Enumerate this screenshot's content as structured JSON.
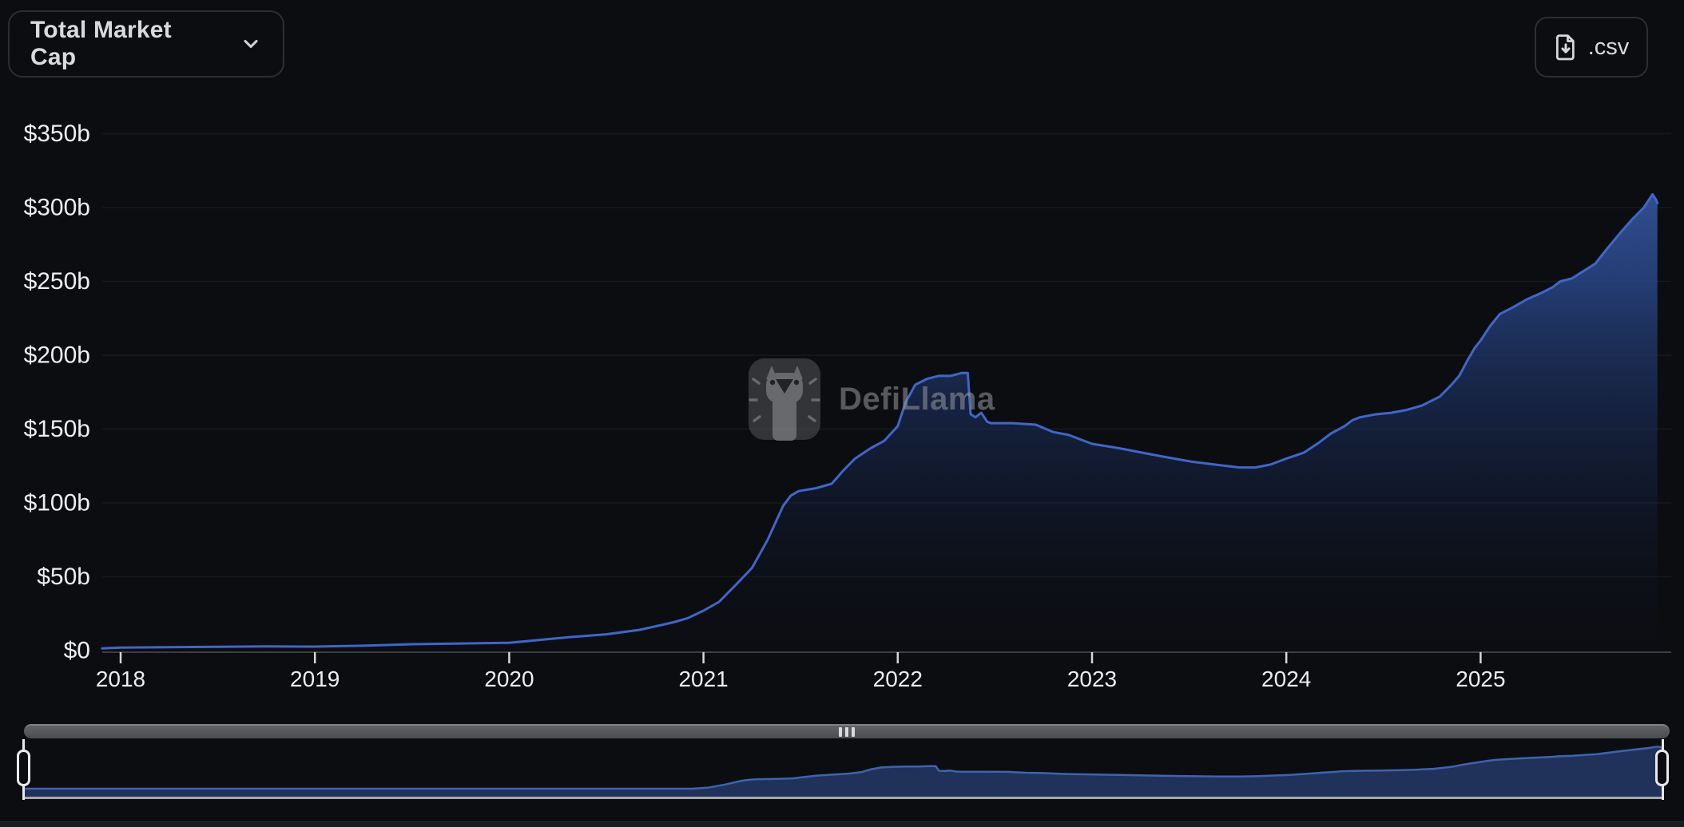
{
  "header": {
    "dropdown": {
      "label": "Total Market Cap"
    },
    "csv_button": {
      "label": ".csv"
    }
  },
  "watermark": {
    "text": "DefiLlama"
  },
  "colors": {
    "background": "#0c0d10",
    "line": "#4066c9",
    "area_top": "#3c60ae",
    "axis_text": "#edeeef",
    "axis_line": "#3d3e43",
    "tick": "#d6d7d9",
    "button_border": "#2c2e33",
    "button_text": "#d9dadc",
    "navigator_fill": "#22355e",
    "navigator_line": "#3e63b2",
    "scrollbar": "#55565a"
  },
  "chart_data": {
    "type": "area",
    "title": "Total Market Cap",
    "unit": "USD billions",
    "legend": [],
    "grid": "faint horizontal lines at each $50b",
    "x_axis": {
      "ticks": [
        2018,
        2019,
        2020,
        2021,
        2022,
        2023,
        2024,
        2025
      ]
    },
    "y_axis": {
      "range": [
        0,
        350
      ],
      "ticks": [
        {
          "value": 0,
          "label": "$0"
        },
        {
          "value": 50,
          "label": "$50b"
        },
        {
          "value": 100,
          "label": "$100b"
        },
        {
          "value": 150,
          "label": "$150b"
        },
        {
          "value": 200,
          "label": "$200b"
        },
        {
          "value": 250,
          "label": "$250b"
        },
        {
          "value": 300,
          "label": "$300b"
        },
        {
          "value": 350,
          "label": "$350b"
        }
      ]
    },
    "series": [
      {
        "name": "Total Market Cap",
        "points": [
          [
            2017.905,
            1.5
          ],
          [
            2018.0,
            2.0
          ],
          [
            2018.25,
            2.3
          ],
          [
            2018.5,
            2.6
          ],
          [
            2018.75,
            2.8
          ],
          [
            2019.0,
            2.7
          ],
          [
            2019.25,
            3.3
          ],
          [
            2019.5,
            4.3
          ],
          [
            2019.75,
            4.8
          ],
          [
            2020.0,
            5.3
          ],
          [
            2020.18,
            7.5
          ],
          [
            2020.3,
            9.0
          ],
          [
            2020.5,
            11.0
          ],
          [
            2020.67,
            14.0
          ],
          [
            2020.84,
            19.0
          ],
          [
            2020.92,
            22.0
          ],
          [
            2021.0,
            27.0
          ],
          [
            2021.08,
            33.0
          ],
          [
            2021.17,
            45.0
          ],
          [
            2021.25,
            56.0
          ],
          [
            2021.33,
            75.0
          ],
          [
            2021.41,
            98.0
          ],
          [
            2021.45,
            105.0
          ],
          [
            2021.49,
            108.0
          ],
          [
            2021.58,
            110.0
          ],
          [
            2021.66,
            113.0
          ],
          [
            2021.72,
            122.0
          ],
          [
            2021.78,
            130.0
          ],
          [
            2021.86,
            137.0
          ],
          [
            2021.93,
            142.0
          ],
          [
            2022.0,
            152.0
          ],
          [
            2022.04,
            168.0
          ],
          [
            2022.09,
            180.0
          ],
          [
            2022.15,
            184.0
          ],
          [
            2022.21,
            186.0
          ],
          [
            2022.27,
            186.0
          ],
          [
            2022.33,
            188.0
          ],
          [
            2022.36,
            188.0
          ],
          [
            2022.375,
            160.0
          ],
          [
            2022.4,
            158.0
          ],
          [
            2022.43,
            161.0
          ],
          [
            2022.46,
            155.0
          ],
          [
            2022.48,
            154.0
          ],
          [
            2022.59,
            154.0
          ],
          [
            2022.71,
            153.0
          ],
          [
            2022.8,
            148.0
          ],
          [
            2022.88,
            146.0
          ],
          [
            2023.0,
            140.0
          ],
          [
            2023.14,
            137.0
          ],
          [
            2023.26,
            134.0
          ],
          [
            2023.38,
            131.0
          ],
          [
            2023.51,
            128.0
          ],
          [
            2023.63,
            126.0
          ],
          [
            2023.76,
            124.0
          ],
          [
            2023.84,
            124.0
          ],
          [
            2023.92,
            126.0
          ],
          [
            2024.0,
            130.0
          ],
          [
            2024.09,
            134.0
          ],
          [
            2024.17,
            141.0
          ],
          [
            2024.23,
            147.0
          ],
          [
            2024.3,
            152.0
          ],
          [
            2024.34,
            156.0
          ],
          [
            2024.38,
            158.0
          ],
          [
            2024.46,
            160.0
          ],
          [
            2024.54,
            161.0
          ],
          [
            2024.62,
            163.0
          ],
          [
            2024.7,
            166.0
          ],
          [
            2024.79,
            172.0
          ],
          [
            2024.85,
            180.0
          ],
          [
            2024.89,
            186.0
          ],
          [
            2024.93,
            196.0
          ],
          [
            2024.97,
            205.0
          ],
          [
            2025.0,
            210.0
          ],
          [
            2025.05,
            220.0
          ],
          [
            2025.1,
            228.0
          ],
          [
            2025.16,
            232.0
          ],
          [
            2025.2,
            235.0
          ],
          [
            2025.24,
            238.0
          ],
          [
            2025.31,
            242.0
          ],
          [
            2025.37,
            246.0
          ],
          [
            2025.41,
            250.0
          ],
          [
            2025.47,
            252.0
          ],
          [
            2025.53,
            257.0
          ],
          [
            2025.59,
            262.0
          ],
          [
            2025.65,
            272.0
          ],
          [
            2025.72,
            283.0
          ],
          [
            2025.78,
            292.0
          ],
          [
            2025.84,
            300.0
          ],
          [
            2025.86,
            304.0
          ],
          [
            2025.885,
            309.0
          ],
          [
            2025.9,
            306.0
          ],
          [
            2025.91,
            303.0
          ]
        ]
      }
    ],
    "navigator": {
      "shows_full_range": true,
      "left_handle_at_start": true,
      "right_handle_at_end": true
    }
  }
}
